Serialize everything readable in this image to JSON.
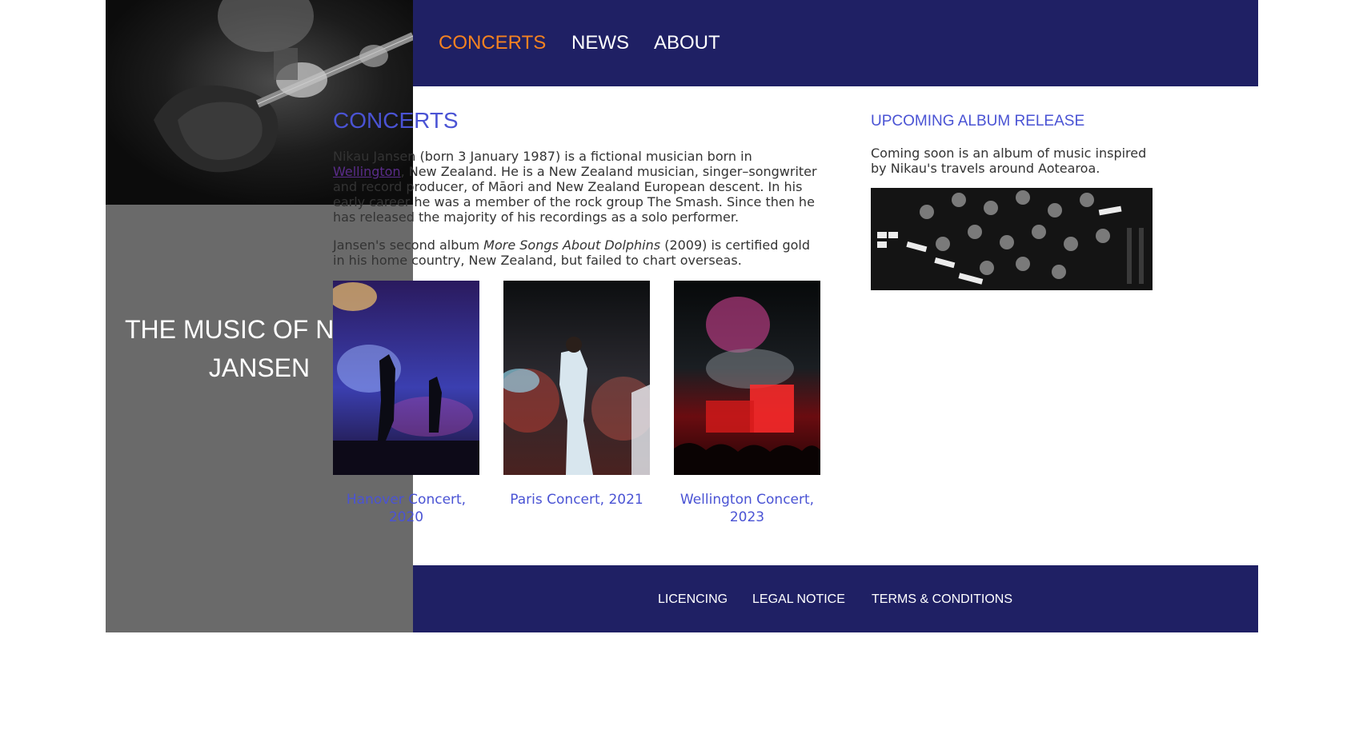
{
  "nav": {
    "items": [
      "CONCERTS",
      "NEWS",
      "ABOUT"
    ],
    "active": "CONCERTS"
  },
  "sidebar": {
    "title_line1": "THE MUSIC OF NIKAU",
    "title_line2": "JANSEN"
  },
  "main": {
    "title": "CONCERTS",
    "para1_before_link": "Nikau Jansen (born 3 January 1987) is a fictional musician born in ",
    "para1_link": "Wellington",
    "para1_after_link": ", New Zealand. He is a New Zealand musician, singer–songwriter and record producer, of Māori and New Zealand European descent. In his early career he was a member of the rock group The Smash. Since then he has released the majority of his recordings as a solo performer.",
    "para2_before_em": "Jansen's second album ",
    "para2_em": "More Songs About Dolphins",
    "para2_after_em": " (2009) is certified gold in his home country, New Zealand, but failed to chart overseas.",
    "gallery": [
      {
        "caption_line1": "Hanover Concert,",
        "caption_line2": "2020"
      },
      {
        "caption_line1": "Paris Concert, 2021",
        "caption_line2": ""
      },
      {
        "caption_line1": "Wellington Concert,",
        "caption_line2": "2023"
      }
    ]
  },
  "aside": {
    "title": "UPCOMING ALBUM RELEASE",
    "text": "Coming soon is an album of music inspired by Nikau's travels around Aotearoa."
  },
  "footer": {
    "links": [
      "LICENCING",
      "LEGAL NOTICE",
      "TERMS & CONDITIONS"
    ]
  },
  "colors": {
    "nav_bg": "#1f2064",
    "accent_active": "#f58220",
    "heading": "#4a53d4",
    "sidebar_bg": "#6a6a6a",
    "link_visited": "#5a2c8a"
  }
}
